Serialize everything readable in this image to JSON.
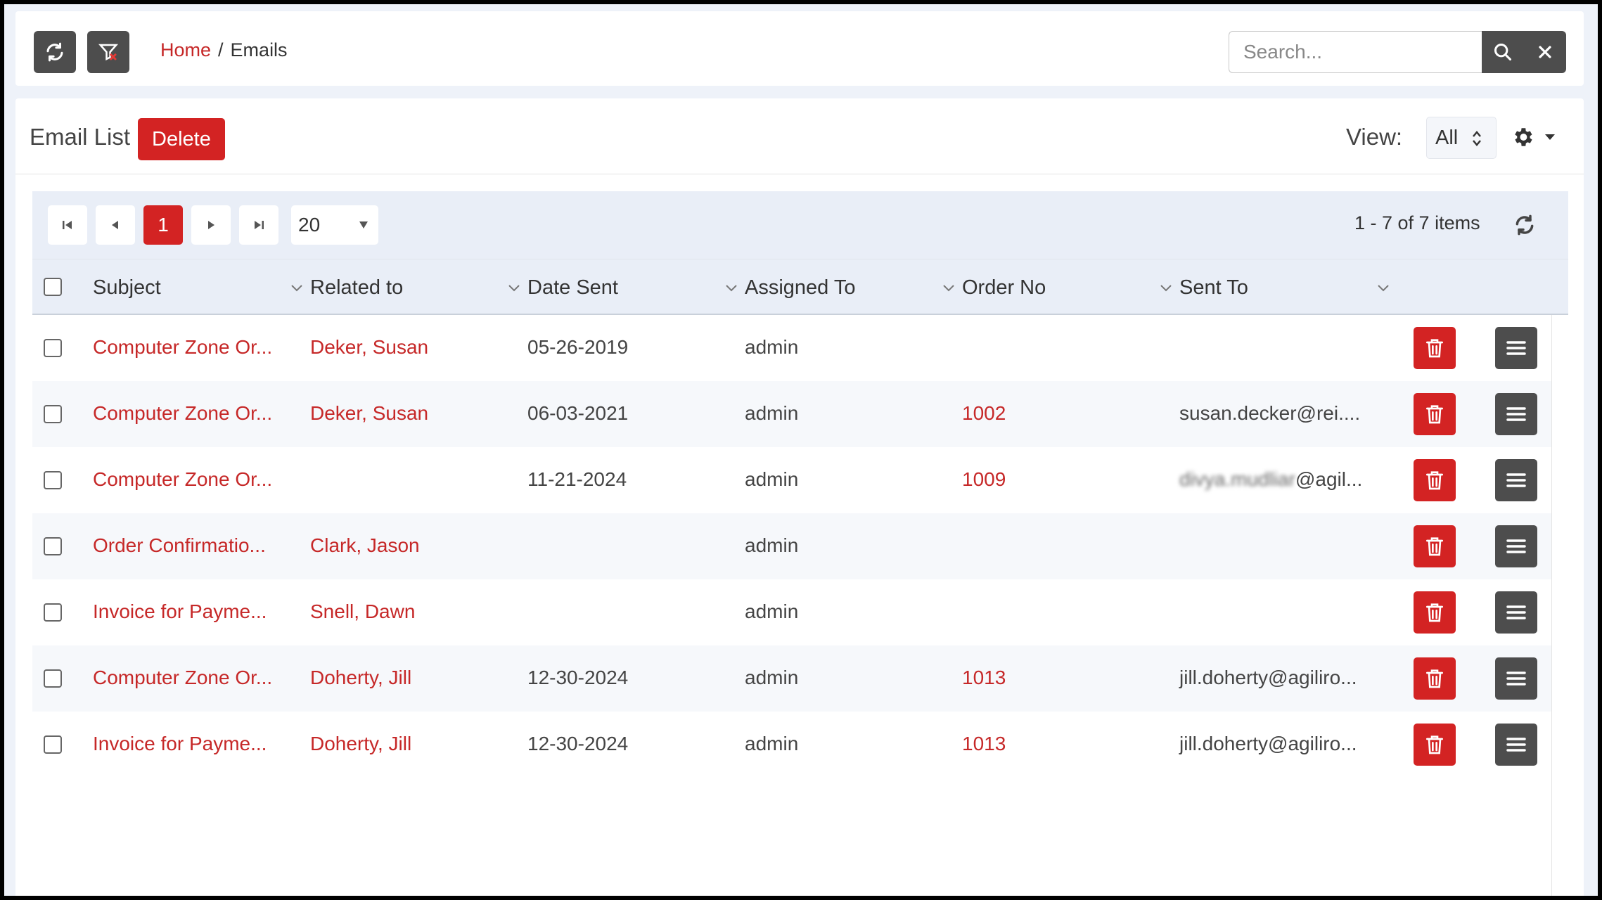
{
  "topbar": {
    "refresh_icon": "refresh-icon",
    "filter_icon": "filter-clear-icon",
    "breadcrumb": {
      "home": "Home",
      "separator": "/",
      "current": "Emails"
    },
    "search": {
      "placeholder": "Search...",
      "value": ""
    }
  },
  "panel": {
    "title": "Email List",
    "delete_label": "Delete",
    "view_label": "View:",
    "view_value": "All"
  },
  "pager": {
    "current_page": "1",
    "page_size": "20",
    "info": "1 - 7 of 7 items"
  },
  "columns": [
    "Subject",
    "Related to",
    "Date Sent",
    "Assigned To",
    "Order No",
    "Sent To"
  ],
  "rows": [
    {
      "subject": "Computer Zone Or...",
      "related": "Deker, Susan",
      "date": "05-26-2019",
      "assigned": "admin",
      "order": "",
      "sent_to": ""
    },
    {
      "subject": "Computer Zone Or...",
      "related": "Deker, Susan",
      "date": "06-03-2021",
      "assigned": "admin",
      "order": "1002",
      "sent_to": "susan.decker@rei...."
    },
    {
      "subject": "Computer Zone Or...",
      "related": "",
      "date": "11-21-2024",
      "assigned": "admin",
      "order": "1009",
      "sent_to_blurred": "divya.mudliar",
      "sent_to": "@agil..."
    },
    {
      "subject": "Order Confirmatio...",
      "related": "Clark, Jason",
      "date": "",
      "assigned": "admin",
      "order": "",
      "sent_to": ""
    },
    {
      "subject": "Invoice for Payme...",
      "related": "Snell, Dawn",
      "date": "",
      "assigned": "admin",
      "order": "",
      "sent_to": ""
    },
    {
      "subject": "Computer Zone Or...",
      "related": "Doherty, Jill",
      "date": "12-30-2024",
      "assigned": "admin",
      "order": "1013",
      "sent_to": "jill.doherty@agiliro..."
    },
    {
      "subject": "Invoice for Payme...",
      "related": "Doherty, Jill",
      "date": "12-30-2024",
      "assigned": "admin",
      "order": "1013",
      "sent_to": "jill.doherty@agiliro..."
    }
  ],
  "colors": {
    "accent": "#d32323",
    "link": "#c62828",
    "dark_button": "#4d4d4d",
    "header_bg": "#e9eef7"
  }
}
